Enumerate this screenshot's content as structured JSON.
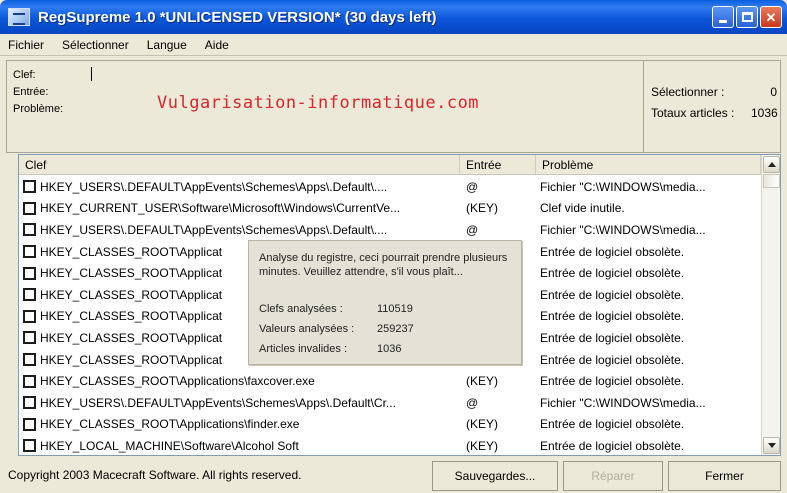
{
  "window": {
    "title": "RegSupreme 1.0 *UNLICENSED VERSION* (30 days left)"
  },
  "menu": [
    "Fichier",
    "Sélectionner",
    "Langue",
    "Aide"
  ],
  "info": {
    "labels": [
      "Clef:",
      "Entrée:",
      "Problème:"
    ],
    "watermark": "Vulgarisation-informatique.com",
    "stats": [
      {
        "label": "Sélectionner :",
        "value": "0"
      },
      {
        "label": "Totaux articles :",
        "value": "1036"
      }
    ]
  },
  "table": {
    "headers": {
      "key": "Clef",
      "entry": "Entrée",
      "problem": "Problème"
    },
    "rows": [
      {
        "key": "HKEY_USERS\\.DEFAULT\\AppEvents\\Schemes\\Apps\\.Default\\....",
        "entry": "@",
        "problem": "Fichier \"C:\\WINDOWS\\media..."
      },
      {
        "key": "HKEY_CURRENT_USER\\Software\\Microsoft\\Windows\\CurrentVe...",
        "entry": "(KEY)",
        "problem": "Clef vide inutile."
      },
      {
        "key": "HKEY_USERS\\.DEFAULT\\AppEvents\\Schemes\\Apps\\.Default\\....",
        "entry": "@",
        "problem": "Fichier \"C:\\WINDOWS\\media..."
      },
      {
        "key": "HKEY_CLASSES_ROOT\\Applicat",
        "entry": "",
        "problem": "Entrée de logiciel obsolète."
      },
      {
        "key": "HKEY_CLASSES_ROOT\\Applicat",
        "entry": "",
        "problem": "Entrée de logiciel obsolète."
      },
      {
        "key": "HKEY_CLASSES_ROOT\\Applicat",
        "entry": "",
        "problem": "Entrée de logiciel obsolète."
      },
      {
        "key": "HKEY_CLASSES_ROOT\\Applicat",
        "entry": "",
        "problem": "Entrée de logiciel obsolète."
      },
      {
        "key": "HKEY_CLASSES_ROOT\\Applicat",
        "entry": "",
        "problem": "Entrée de logiciel obsolète."
      },
      {
        "key": "HKEY_CLASSES_ROOT\\Applicat",
        "entry": "",
        "problem": "Entrée de logiciel obsolète."
      },
      {
        "key": "HKEY_CLASSES_ROOT\\Applications\\faxcover.exe",
        "entry": "(KEY)",
        "problem": "Entrée de logiciel obsolète."
      },
      {
        "key": "HKEY_USERS\\.DEFAULT\\AppEvents\\Schemes\\Apps\\.Default\\Cr...",
        "entry": "@",
        "problem": "Fichier \"C:\\WINDOWS\\media..."
      },
      {
        "key": "HKEY_CLASSES_ROOT\\Applications\\finder.exe",
        "entry": "(KEY)",
        "problem": "Entrée de logiciel obsolète."
      },
      {
        "key": "HKEY_LOCAL_MACHINE\\Software\\Alcohol Soft",
        "entry": "(KEY)",
        "problem": "Entrée de logiciel obsolète."
      }
    ]
  },
  "progress": {
    "message": "Analyse du registre, ceci pourrait prendre plusieurs minutes. Veuillez attendre, s'il vous plaît...",
    "stats": [
      {
        "label": "Clefs analysées :",
        "value": "110519"
      },
      {
        "label": "Valeurs analysées :",
        "value": "259237"
      },
      {
        "label": "Articles invalides :",
        "value": "1036"
      }
    ]
  },
  "status": {
    "copyright": "Copyright 2003 Macecraft Software. All rights reserved.",
    "buttons": {
      "save": "Sauvegardes...",
      "repair": "Réparer",
      "close": "Fermer"
    }
  }
}
